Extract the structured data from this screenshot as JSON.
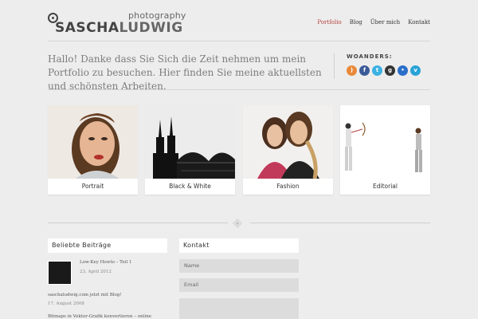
{
  "header": {
    "logo_sub": "photography",
    "logo_main_1": "SASCHA",
    "logo_main_2": "LUDWIG",
    "nav": [
      "Portfolio",
      "Blog",
      "Über mich",
      "Kontakt"
    ],
    "nav_active": "Portfolio"
  },
  "intro": {
    "text": "Hallo! Danke dass Sie Sich die Zeit nehmen um mein Portfolio zu besuchen. Hier finden Sie meine aktuellsten und schönsten Arbeiten."
  },
  "woanders": {
    "title": "WOANDERS:",
    "icons": [
      {
        "name": "rss-icon",
        "color": "#e8893a",
        "glyph": ")"
      },
      {
        "name": "facebook-icon",
        "color": "#3b5a98",
        "glyph": "f"
      },
      {
        "name": "twitter-icon",
        "color": "#3cb1e3",
        "glyph": "t"
      },
      {
        "name": "google-plus-icon",
        "color": "#333333",
        "glyph": "g"
      },
      {
        "name": "flickr-icon",
        "color": "#2a6fc9",
        "glyph": "•"
      },
      {
        "name": "vimeo-icon",
        "color": "#2aa3d6",
        "glyph": "v"
      }
    ]
  },
  "gallery": [
    {
      "caption": "Portrait"
    },
    {
      "caption": "Black & White"
    },
    {
      "caption": "Fashion"
    },
    {
      "caption": "Editorial"
    }
  ],
  "widgets": {
    "beliebte_title": "Beliebte Beiträge",
    "posts": [
      {
        "title": "Low-Key Howto – Teil 1",
        "date": "23. April 2012"
      },
      {
        "title": "saschaludwig.com jetzt mit Blog!",
        "date": "17. August 2008"
      },
      {
        "title": "Bitmaps in Vektor-Grafik konvertieren – online"
      }
    ],
    "kontakt_title": "Kontakt",
    "name_placeholder": "Name",
    "email_placeholder": "Email"
  },
  "colors": {
    "accent": "#b2423c",
    "background": "#ededed"
  }
}
